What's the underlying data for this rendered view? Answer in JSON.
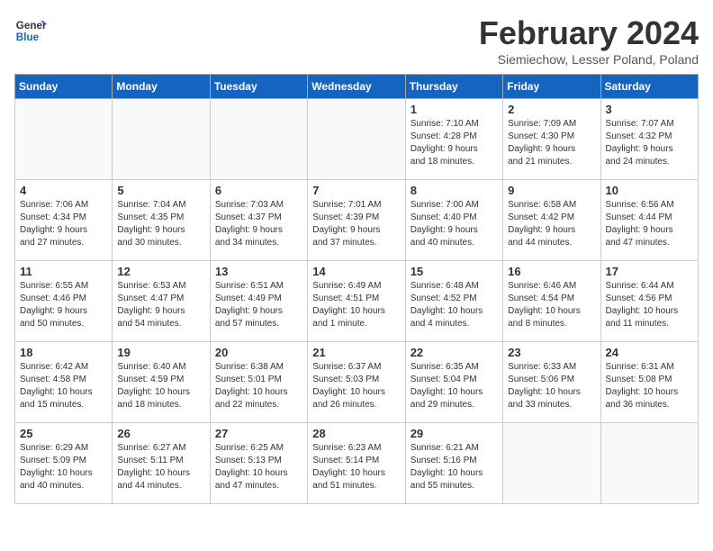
{
  "logo": {
    "line1": "General",
    "line2": "Blue"
  },
  "title": "February 2024",
  "subtitle": "Siemiechow, Lesser Poland, Poland",
  "weekdays": [
    "Sunday",
    "Monday",
    "Tuesday",
    "Wednesday",
    "Thursday",
    "Friday",
    "Saturday"
  ],
  "weeks": [
    [
      {
        "day": "",
        "info": ""
      },
      {
        "day": "",
        "info": ""
      },
      {
        "day": "",
        "info": ""
      },
      {
        "day": "",
        "info": ""
      },
      {
        "day": "1",
        "info": "Sunrise: 7:10 AM\nSunset: 4:28 PM\nDaylight: 9 hours\nand 18 minutes."
      },
      {
        "day": "2",
        "info": "Sunrise: 7:09 AM\nSunset: 4:30 PM\nDaylight: 9 hours\nand 21 minutes."
      },
      {
        "day": "3",
        "info": "Sunrise: 7:07 AM\nSunset: 4:32 PM\nDaylight: 9 hours\nand 24 minutes."
      }
    ],
    [
      {
        "day": "4",
        "info": "Sunrise: 7:06 AM\nSunset: 4:34 PM\nDaylight: 9 hours\nand 27 minutes."
      },
      {
        "day": "5",
        "info": "Sunrise: 7:04 AM\nSunset: 4:35 PM\nDaylight: 9 hours\nand 30 minutes."
      },
      {
        "day": "6",
        "info": "Sunrise: 7:03 AM\nSunset: 4:37 PM\nDaylight: 9 hours\nand 34 minutes."
      },
      {
        "day": "7",
        "info": "Sunrise: 7:01 AM\nSunset: 4:39 PM\nDaylight: 9 hours\nand 37 minutes."
      },
      {
        "day": "8",
        "info": "Sunrise: 7:00 AM\nSunset: 4:40 PM\nDaylight: 9 hours\nand 40 minutes."
      },
      {
        "day": "9",
        "info": "Sunrise: 6:58 AM\nSunset: 4:42 PM\nDaylight: 9 hours\nand 44 minutes."
      },
      {
        "day": "10",
        "info": "Sunrise: 6:56 AM\nSunset: 4:44 PM\nDaylight: 9 hours\nand 47 minutes."
      }
    ],
    [
      {
        "day": "11",
        "info": "Sunrise: 6:55 AM\nSunset: 4:46 PM\nDaylight: 9 hours\nand 50 minutes."
      },
      {
        "day": "12",
        "info": "Sunrise: 6:53 AM\nSunset: 4:47 PM\nDaylight: 9 hours\nand 54 minutes."
      },
      {
        "day": "13",
        "info": "Sunrise: 6:51 AM\nSunset: 4:49 PM\nDaylight: 9 hours\nand 57 minutes."
      },
      {
        "day": "14",
        "info": "Sunrise: 6:49 AM\nSunset: 4:51 PM\nDaylight: 10 hours\nand 1 minute."
      },
      {
        "day": "15",
        "info": "Sunrise: 6:48 AM\nSunset: 4:52 PM\nDaylight: 10 hours\nand 4 minutes."
      },
      {
        "day": "16",
        "info": "Sunrise: 6:46 AM\nSunset: 4:54 PM\nDaylight: 10 hours\nand 8 minutes."
      },
      {
        "day": "17",
        "info": "Sunrise: 6:44 AM\nSunset: 4:56 PM\nDaylight: 10 hours\nand 11 minutes."
      }
    ],
    [
      {
        "day": "18",
        "info": "Sunrise: 6:42 AM\nSunset: 4:58 PM\nDaylight: 10 hours\nand 15 minutes."
      },
      {
        "day": "19",
        "info": "Sunrise: 6:40 AM\nSunset: 4:59 PM\nDaylight: 10 hours\nand 18 minutes."
      },
      {
        "day": "20",
        "info": "Sunrise: 6:38 AM\nSunset: 5:01 PM\nDaylight: 10 hours\nand 22 minutes."
      },
      {
        "day": "21",
        "info": "Sunrise: 6:37 AM\nSunset: 5:03 PM\nDaylight: 10 hours\nand 26 minutes."
      },
      {
        "day": "22",
        "info": "Sunrise: 6:35 AM\nSunset: 5:04 PM\nDaylight: 10 hours\nand 29 minutes."
      },
      {
        "day": "23",
        "info": "Sunrise: 6:33 AM\nSunset: 5:06 PM\nDaylight: 10 hours\nand 33 minutes."
      },
      {
        "day": "24",
        "info": "Sunrise: 6:31 AM\nSunset: 5:08 PM\nDaylight: 10 hours\nand 36 minutes."
      }
    ],
    [
      {
        "day": "25",
        "info": "Sunrise: 6:29 AM\nSunset: 5:09 PM\nDaylight: 10 hours\nand 40 minutes."
      },
      {
        "day": "26",
        "info": "Sunrise: 6:27 AM\nSunset: 5:11 PM\nDaylight: 10 hours\nand 44 minutes."
      },
      {
        "day": "27",
        "info": "Sunrise: 6:25 AM\nSunset: 5:13 PM\nDaylight: 10 hours\nand 47 minutes."
      },
      {
        "day": "28",
        "info": "Sunrise: 6:23 AM\nSunset: 5:14 PM\nDaylight: 10 hours\nand 51 minutes."
      },
      {
        "day": "29",
        "info": "Sunrise: 6:21 AM\nSunset: 5:16 PM\nDaylight: 10 hours\nand 55 minutes."
      },
      {
        "day": "",
        "info": ""
      },
      {
        "day": "",
        "info": ""
      }
    ]
  ]
}
